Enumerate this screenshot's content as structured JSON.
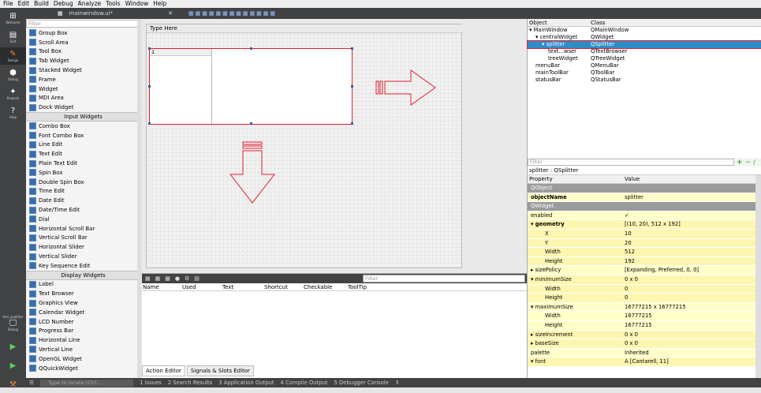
{
  "menubar": [
    "File",
    "Edit",
    "Build",
    "Debug",
    "Analyze",
    "Tools",
    "Window",
    "Help"
  ],
  "modes": [
    {
      "icon": "⊞",
      "label": "Welcome"
    },
    {
      "icon": "▤",
      "label": "Edit"
    },
    {
      "icon": "✎",
      "label": "Design"
    },
    {
      "icon": "⬢",
      "label": "Debug"
    },
    {
      "icon": "✦",
      "label": "Projects"
    },
    {
      "icon": "?",
      "label": "Help"
    }
  ],
  "kit": {
    "project": "test_qsplitter",
    "mode": "Debug"
  },
  "filebar": {
    "filename": "mainwindow.ui*"
  },
  "widgetbox": {
    "filter_placeholder": "Filter",
    "items": [
      {
        "t": "item",
        "label": "Group Box"
      },
      {
        "t": "item",
        "label": "Scroll Area"
      },
      {
        "t": "item",
        "label": "Tool Box"
      },
      {
        "t": "item",
        "label": "Tab Widget"
      },
      {
        "t": "item",
        "label": "Stacked Widget"
      },
      {
        "t": "item",
        "label": "Frame"
      },
      {
        "t": "item",
        "label": "Widget"
      },
      {
        "t": "item",
        "label": "MDI Area"
      },
      {
        "t": "item",
        "label": "Dock Widget"
      },
      {
        "t": "cat",
        "label": "Input Widgets"
      },
      {
        "t": "item",
        "label": "Combo Box"
      },
      {
        "t": "item",
        "label": "Font Combo Box"
      },
      {
        "t": "item",
        "label": "Line Edit"
      },
      {
        "t": "item",
        "label": "Text Edit"
      },
      {
        "t": "item",
        "label": "Plain Text Edit"
      },
      {
        "t": "item",
        "label": "Spin Box"
      },
      {
        "t": "item",
        "label": "Double Spin Box"
      },
      {
        "t": "item",
        "label": "Time Edit"
      },
      {
        "t": "item",
        "label": "Date Edit"
      },
      {
        "t": "item",
        "label": "Date/Time Edit"
      },
      {
        "t": "item",
        "label": "Dial"
      },
      {
        "t": "item",
        "label": "Horizontal Scroll Bar"
      },
      {
        "t": "item",
        "label": "Vertical Scroll Bar"
      },
      {
        "t": "item",
        "label": "Horizontal Slider"
      },
      {
        "t": "item",
        "label": "Vertical Slider"
      },
      {
        "t": "item",
        "label": "Key Sequence Edit"
      },
      {
        "t": "cat",
        "label": "Display Widgets"
      },
      {
        "t": "item",
        "label": "Label"
      },
      {
        "t": "item",
        "label": "Text Browser"
      },
      {
        "t": "item",
        "label": "Graphics View"
      },
      {
        "t": "item",
        "label": "Calendar Widget"
      },
      {
        "t": "item",
        "label": "LCD Number"
      },
      {
        "t": "item",
        "label": "Progress Bar"
      },
      {
        "t": "item",
        "label": "Horizontal Line"
      },
      {
        "t": "item",
        "label": "Vertical Line"
      },
      {
        "t": "item",
        "label": "OpenGL Widget"
      },
      {
        "t": "item",
        "label": "QQuickWidget"
      }
    ]
  },
  "form": {
    "menu_placeholder": "Type Here",
    "tree_header": "1"
  },
  "action_editor": {
    "filter_placeholder": "Filter",
    "columns": [
      "Name",
      "Used",
      "Text",
      "Shortcut",
      "Checkable",
      "ToolTip"
    ],
    "tabs": [
      "Action Editor",
      "Signals & Slots Editor"
    ]
  },
  "object_inspector": {
    "headers": [
      "Object",
      "Class"
    ],
    "rows": [
      {
        "obj": "▾ MainWindow",
        "cls": "QMainWindow",
        "ind": 0
      },
      {
        "obj": "▾ centralWidget",
        "cls": "QWidget",
        "ind": 1
      },
      {
        "obj": "▾ splitter",
        "cls": "QSplitter",
        "ind": 2,
        "sel": true
      },
      {
        "obj": "text...wser",
        "cls": "QTextBrowser",
        "ind": 3
      },
      {
        "obj": "treeWidget",
        "cls": "QTreeWidget",
        "ind": 3
      },
      {
        "obj": "menuBar",
        "cls": "QMenuBar",
        "ind": 1
      },
      {
        "obj": "mainToolBar",
        "cls": "QToolBar",
        "ind": 1
      },
      {
        "obj": "statusBar",
        "cls": "QStatusBar",
        "ind": 1
      }
    ]
  },
  "property_editor": {
    "filter_placeholder": "Filter",
    "title": "splitter : QSplitter",
    "headers": [
      "Property",
      "Value"
    ],
    "rows": [
      {
        "n": "QObject",
        "v": "",
        "k": "group"
      },
      {
        "n": "objectName",
        "v": "splitter",
        "k": "yellow bold"
      },
      {
        "n": "QWidget",
        "v": "",
        "k": "group"
      },
      {
        "n": "enabled",
        "v": "✓",
        "k": "yellow"
      },
      {
        "n": "▾ geometry",
        "v": "[(10, 20), 512 x 192]",
        "k": "yellow2 bold"
      },
      {
        "n": "X",
        "v": "10",
        "k": "yellow2 sub"
      },
      {
        "n": "Y",
        "v": "20",
        "k": "yellow2 sub"
      },
      {
        "n": "Width",
        "v": "512",
        "k": "yellow2 sub"
      },
      {
        "n": "Height",
        "v": "192",
        "k": "yellow2 sub"
      },
      {
        "n": "▸ sizePolicy",
        "v": "[Expanding, Preferred, 0, 0]",
        "k": "yellow"
      },
      {
        "n": "▾ minimumSize",
        "v": "0 x 0",
        "k": "yellow2"
      },
      {
        "n": "Width",
        "v": "0",
        "k": "yellow2 sub"
      },
      {
        "n": "Height",
        "v": "0",
        "k": "yellow2 sub"
      },
      {
        "n": "▾ maximumSize",
        "v": "16777215 x 16777215",
        "k": "yellow"
      },
      {
        "n": "Width",
        "v": "16777215",
        "k": "yellow sub"
      },
      {
        "n": "Height",
        "v": "16777215",
        "k": "yellow sub"
      },
      {
        "n": "▸ sizeIncrement",
        "v": "0 x 0",
        "k": "yellow2"
      },
      {
        "n": "▸ baseSize",
        "v": "0 x 0",
        "k": "yellow2"
      },
      {
        "n": "palette",
        "v": "Inherited",
        "k": "yellow"
      },
      {
        "n": "▾ font",
        "v": "A  [Cantarell, 11]",
        "k": "yellow2"
      }
    ]
  },
  "statusbar": {
    "locate_placeholder": "Type to locate (Ctrl...",
    "panes": [
      "1 Issues",
      "2 Search Results",
      "3 Application Output",
      "4 Compile Output",
      "5 Debugger Console",
      "⇕"
    ]
  },
  "colors": {
    "selection": "#308cc6",
    "highlight": "#e02030",
    "sidebar": "#404244"
  }
}
